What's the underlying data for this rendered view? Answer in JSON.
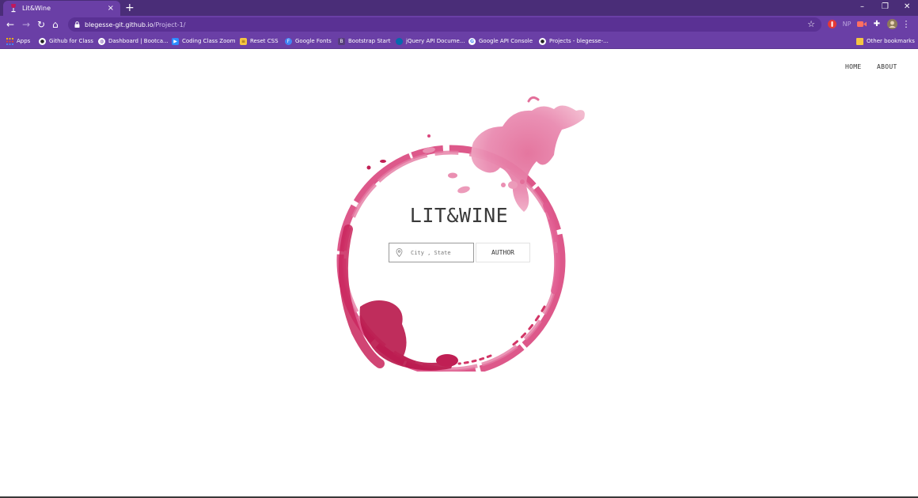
{
  "browser": {
    "tab_title": "Lit&Wine",
    "new_tab": "+",
    "url_host": "blegesse-git.github.io",
    "url_path": "/Project-1/",
    "extensions": [
      "np-icon"
    ],
    "ext_np": "NP"
  },
  "bookmarks": [
    {
      "label": "Apps",
      "icon": "apps-grid-icon"
    },
    {
      "label": "Github for Class",
      "icon": "github-icon"
    },
    {
      "label": "Dashboard | Bootca...",
      "icon": "globe-icon"
    },
    {
      "label": "Coding Class Zoom",
      "icon": "zoom-icon"
    },
    {
      "label": "Reset CSS",
      "icon": "reset-css-icon"
    },
    {
      "label": "Google Fonts",
      "icon": "google-fonts-icon"
    },
    {
      "label": "Bootstrap Start",
      "icon": "bootstrap-icon"
    },
    {
      "label": "jQuery API Docume...",
      "icon": "jquery-icon"
    },
    {
      "label": "Google API Console",
      "icon": "google-icon"
    },
    {
      "label": "Projects - blegesse-...",
      "icon": "github-icon"
    },
    {
      "label": "Other bookmarks",
      "icon": "folder-icon"
    }
  ],
  "nav": {
    "home": "HOME",
    "about": "ABOUT"
  },
  "hero": {
    "title": "LIT&WINE",
    "search_placeholder": "City , State",
    "author_button": "AUTHOR"
  },
  "colors": {
    "tab_strip": "#4a2d78",
    "toolbar": "#6a3fa6",
    "wine": "#d6336c"
  }
}
